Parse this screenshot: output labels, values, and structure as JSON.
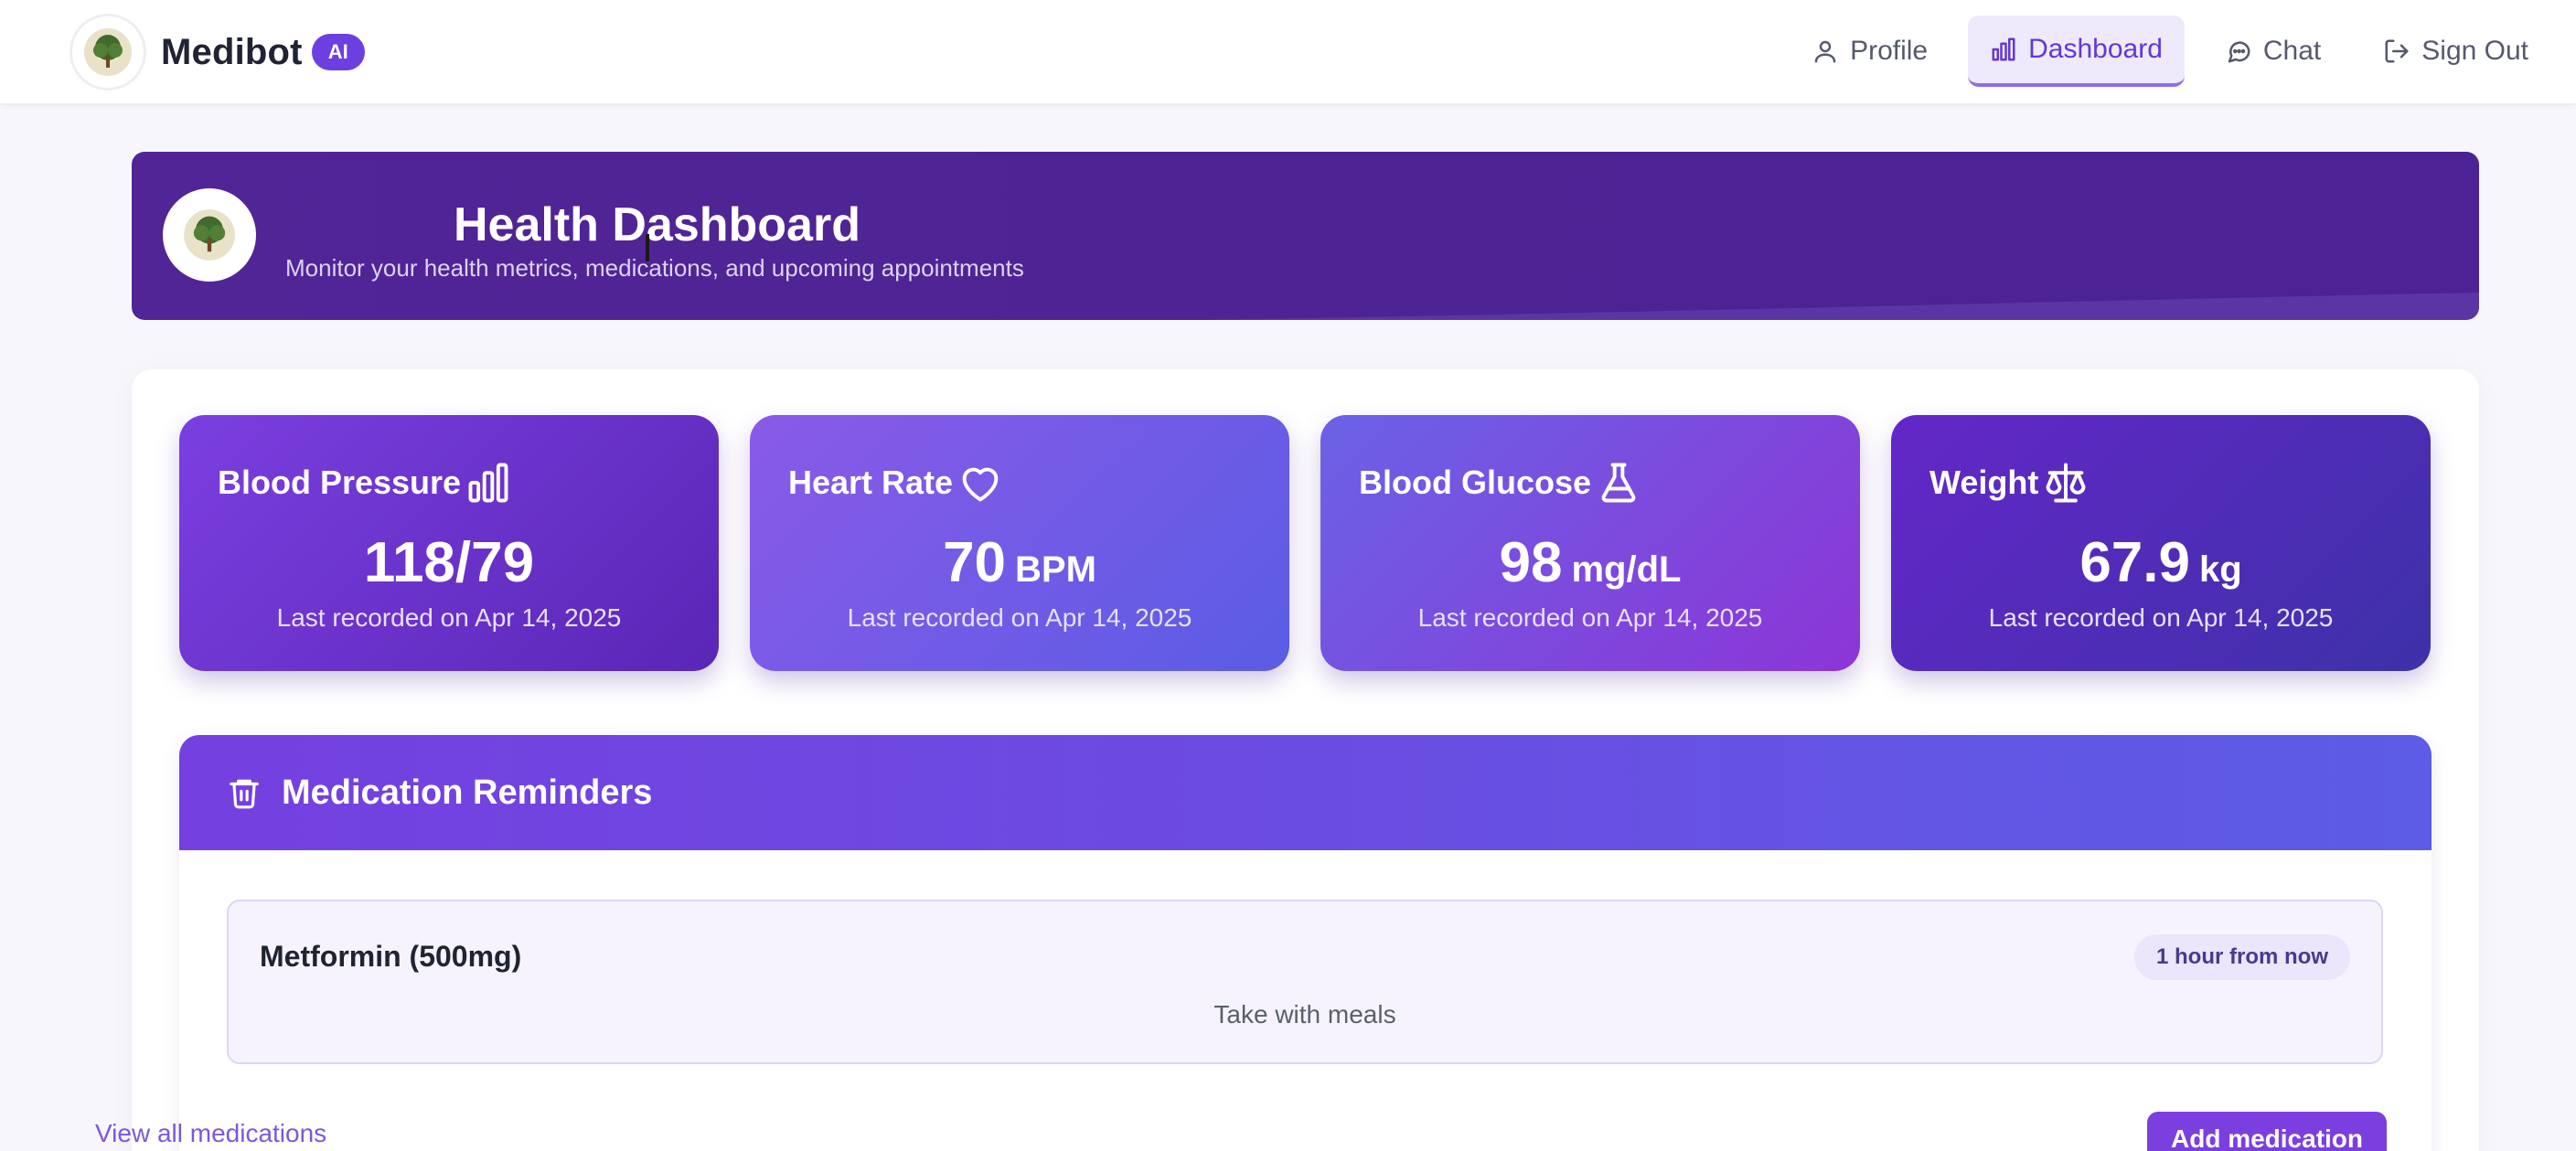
{
  "app": {
    "name": "Medibot",
    "badge": "AI"
  },
  "nav": {
    "items": [
      {
        "label": "Profile",
        "icon": "user-icon",
        "active": false
      },
      {
        "label": "Dashboard",
        "icon": "bar-chart-icon",
        "active": true
      },
      {
        "label": "Chat",
        "icon": "chat-bubble-icon",
        "active": false
      },
      {
        "label": "Sign Out",
        "icon": "sign-out-icon",
        "active": false
      }
    ]
  },
  "hero": {
    "title": "Health Dashboard",
    "subtitle": "Monitor your health metrics, medications, and upcoming appointments"
  },
  "metrics": [
    {
      "title": "Blood Pressure",
      "icon": "bar-chart-icon",
      "value": "118/79",
      "unit": "",
      "note": "Last recorded on Apr 14, 2025"
    },
    {
      "title": "Heart Rate",
      "icon": "heart-icon",
      "value": "70",
      "unit": "BPM",
      "note": "Last recorded on Apr 14, 2025"
    },
    {
      "title": "Blood Glucose",
      "icon": "flask-icon",
      "value": "98",
      "unit": "mg/dL",
      "note": "Last recorded on Apr 14, 2025"
    },
    {
      "title": "Weight",
      "icon": "scale-icon",
      "value": "67.9",
      "unit": "kg",
      "note": "Last recorded on Apr 14, 2025"
    }
  ],
  "medication": {
    "title": "Medication Reminders",
    "icon": "trash-icon",
    "items": [
      {
        "name": "Metformin (500mg)",
        "time": "1 hour from now",
        "note": "Take with meals"
      }
    ],
    "view_all": "View all medications",
    "add_button": "Add medication"
  },
  "colors": {
    "accent": "#7b3fe0",
    "hero_bg": "#4e2394",
    "nav_active": "#6437d6"
  }
}
